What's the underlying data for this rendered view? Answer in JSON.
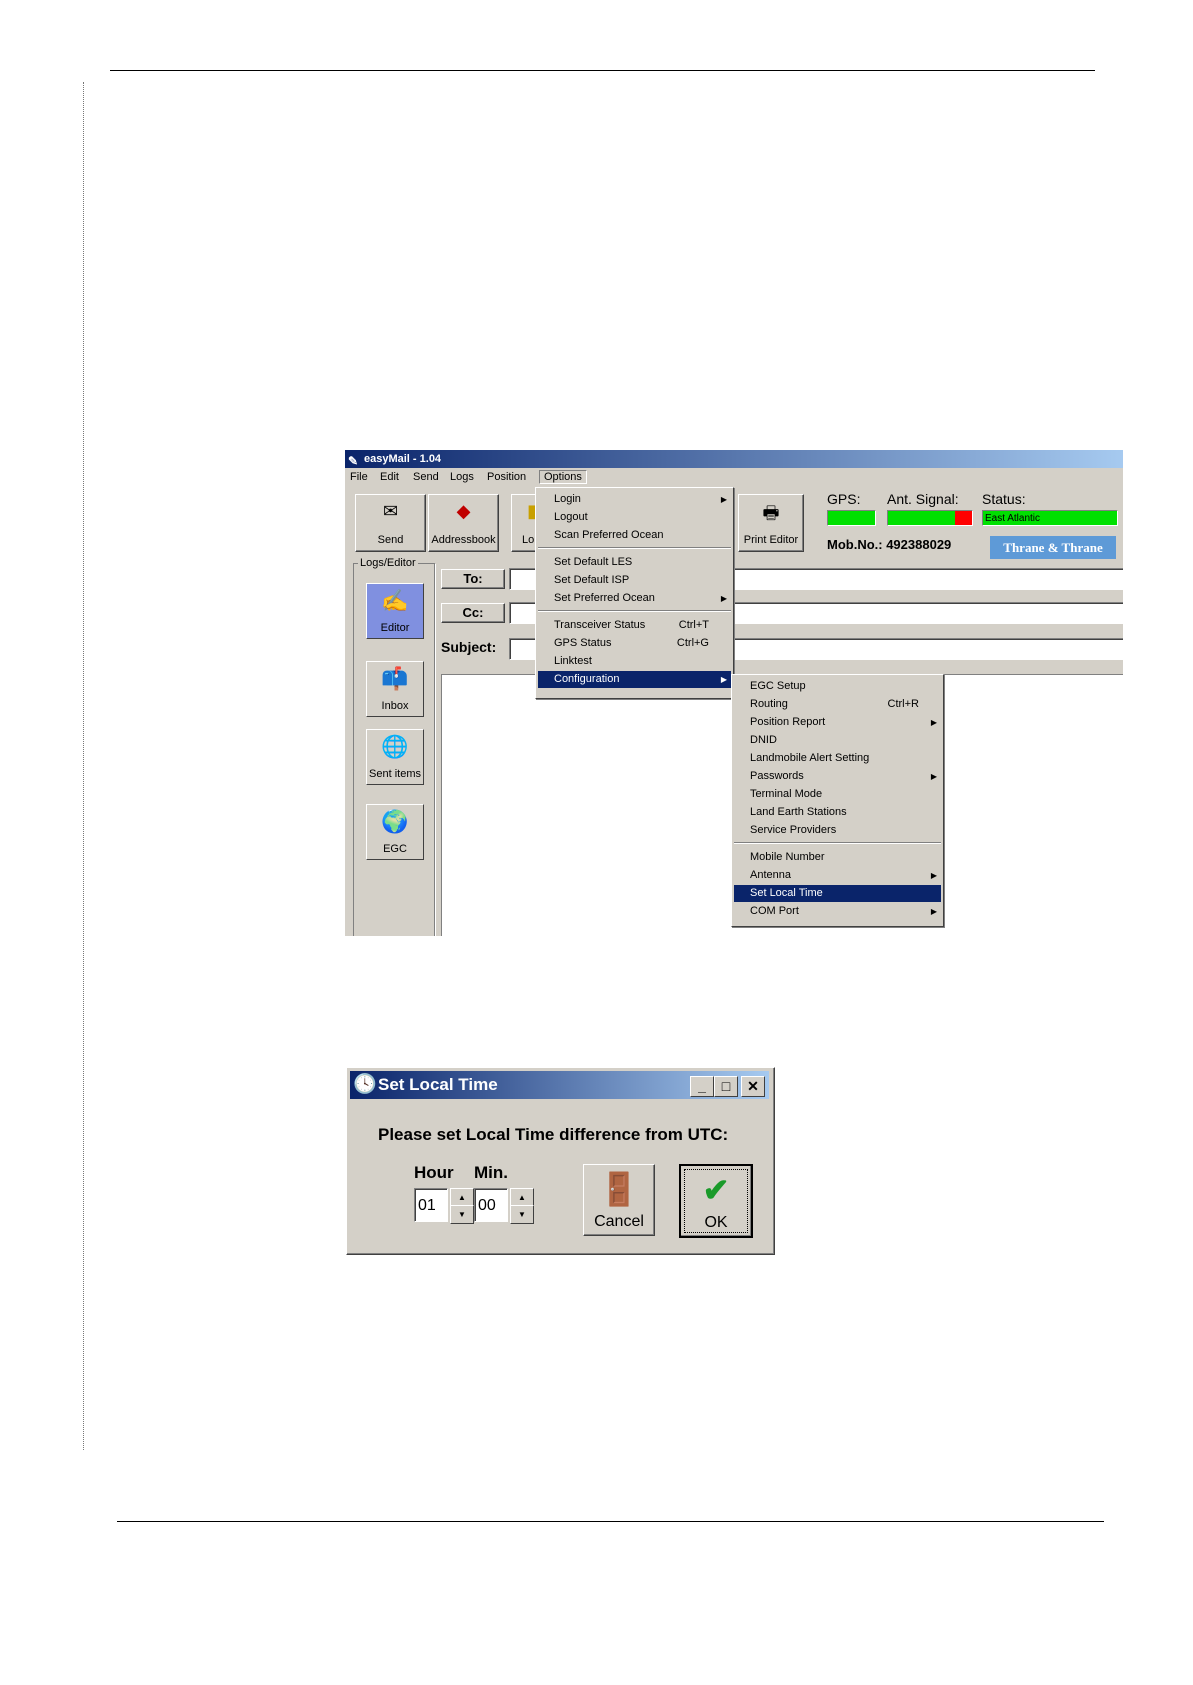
{
  "app": {
    "title": "easyMail - 1.04",
    "menu": [
      "File",
      "Edit",
      "Send",
      "Logs",
      "Position",
      "Options"
    ],
    "toolbar": {
      "send": "Send",
      "addressbook": "Addressbook",
      "logs_partial": "Lo",
      "print_editor": "Print Editor"
    },
    "status": {
      "gps_label": "GPS:",
      "ant_label": "Ant. Signal:",
      "status_label": "Status:",
      "status_value": "East Atlantic",
      "mob_no": "Mob.No.: 492388029",
      "brand": "Thrane & Thrane",
      "signal_level": 0.8
    },
    "logs_editor": {
      "caption": "Logs/Editor",
      "items": [
        "Editor",
        "Inbox",
        "Sent items",
        "EGC"
      ]
    },
    "fields": {
      "to": "To:",
      "cc": "Cc:",
      "subject": "Subject:"
    },
    "options_menu": {
      "login": "Login",
      "logout": "Logout",
      "scan_ocean": "Scan Preferred Ocean",
      "default_les": "Set Default LES",
      "default_isp": "Set Default ISP",
      "preferred_ocean": "Set Preferred Ocean",
      "transceiver": "Transceiver Status",
      "transceiver_sc": "Ctrl+T",
      "gps_status": "GPS Status",
      "gps_sc": "Ctrl+G",
      "linktest": "Linktest",
      "configuration": "Configuration"
    },
    "config_menu": {
      "egc_setup": "EGC Setup",
      "routing": "Routing",
      "routing_sc": "Ctrl+R",
      "position_report": "Position Report",
      "dnid": "DNID",
      "landmobile": "Landmobile Alert Setting",
      "passwords": "Passwords",
      "terminal_mode": "Terminal Mode",
      "land_earth": "Land Earth Stations",
      "service_providers": "Service Providers",
      "mobile_number": "Mobile Number",
      "antenna": "Antenna",
      "set_local_time": "Set Local Time",
      "com_port": "COM Port"
    }
  },
  "dialog": {
    "title": "Set Local Time",
    "prompt": "Please set Local Time difference from UTC:",
    "hour_label": "Hour",
    "min_label": "Min.",
    "hour_value": "01",
    "min_value": "00",
    "cancel": "Cancel",
    "ok": "OK"
  },
  "colors": {
    "titlebar_start": "#0a246a",
    "titlebar_end": "#a6caf0",
    "indicator_green": "#00e000",
    "signal_red": "#ff0000",
    "brand_blue": "#5e9ad7"
  }
}
